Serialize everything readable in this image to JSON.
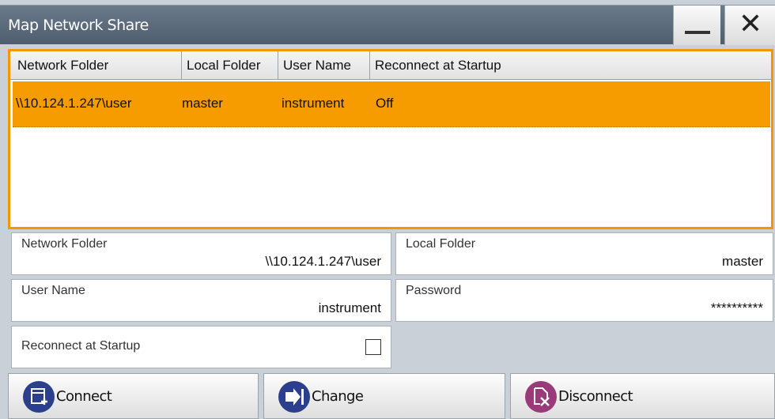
{
  "window": {
    "title": "Map Network Share",
    "minimize_icon": "minimize-icon",
    "close_icon": "close-icon",
    "close_glyph": "✕"
  },
  "table": {
    "columns": [
      "Network Folder",
      "Local Folder",
      "User Name",
      "Reconnect at Startup"
    ],
    "rows": [
      {
        "network_folder": "\\\\10.124.1.247\\user",
        "local_folder": "master",
        "user_name": "instrument",
        "reconnect": "Off",
        "selected": true
      }
    ],
    "selection_color": "#f79c00"
  },
  "form": {
    "network_folder": {
      "label": "Network Folder",
      "value": "\\\\10.124.1.247\\user"
    },
    "local_folder": {
      "label": "Local Folder",
      "value": "master"
    },
    "user_name": {
      "label": "User Name",
      "value": "instrument"
    },
    "password": {
      "label": "Password",
      "value": "**********"
    },
    "reconnect": {
      "label": "Reconnect at Startup",
      "checked": false
    }
  },
  "buttons": {
    "connect": {
      "label": "Connect",
      "icon": "connect-icon"
    },
    "change": {
      "label": "Change",
      "icon": "change-icon"
    },
    "disconnect": {
      "label": "Disconnect",
      "icon": "disconnect-icon"
    }
  }
}
